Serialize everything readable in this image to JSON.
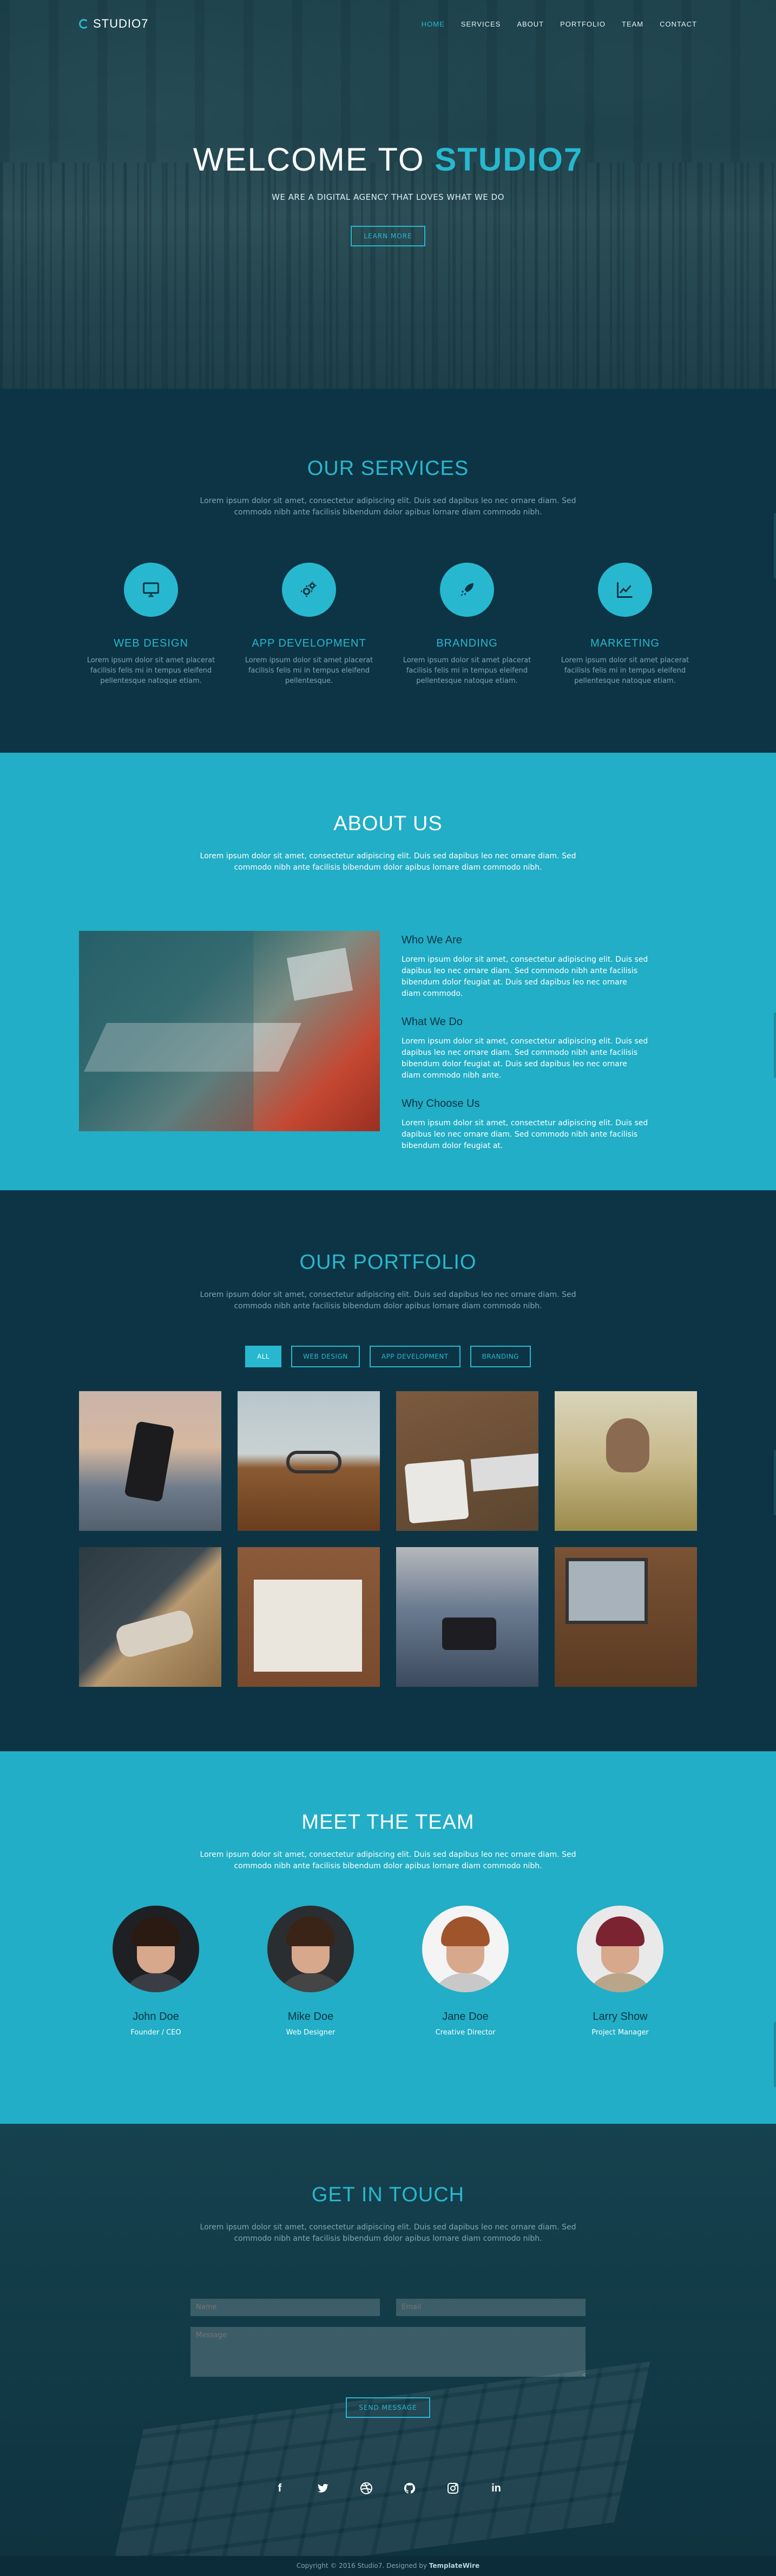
{
  "brand": {
    "name": "STUDIO7"
  },
  "nav": {
    "items": [
      "HOME",
      "SERVICES",
      "ABOUT",
      "PORTFOLIO",
      "TEAM",
      "CONTACT"
    ],
    "active": "HOME"
  },
  "hero": {
    "title_prefix": "WELCOME TO ",
    "title_accent": "STUDIO7",
    "subtitle": "WE ARE A DIGITAL AGENCY THAT LOVES WHAT WE DO",
    "button": "LEARN MORE"
  },
  "lorem": "Lorem ipsum dolor sit amet, consectetur adipiscing elit. Duis sed dapibus leo nec ornare diam. Sed commodo nibh ante facilisis bibendum dolor apibus lornare diam commodo nibh.",
  "services": {
    "title": "OUR SERVICES",
    "text": "Lorem ipsum dolor sit amet, consectetur adipiscing elit. Duis sed dapibus leo nec ornare diam. Sed commodo nibh ante facilisis bibendum dolor apibus lornare diam commodo nibh.",
    "items": [
      {
        "title": "WEB DESIGN",
        "icon": "monitor-icon",
        "text": "Lorem ipsum dolor sit amet placerat facilisis felis mi in tempus eleifend pellentesque natoque etiam."
      },
      {
        "title": "APP DEVELOPMENT",
        "icon": "gears-icon",
        "text": "Lorem ipsum dolor sit amet placerat facilisis felis mi in tempus eleifend pellentesque."
      },
      {
        "title": "BRANDING",
        "icon": "rocket-icon",
        "text": "Lorem ipsum dolor sit amet placerat facilisis felis mi in tempus eleifend pellentesque natoque etiam."
      },
      {
        "title": "MARKETING",
        "icon": "chart-icon",
        "text": "Lorem ipsum dolor sit amet placerat facilisis felis mi in tempus eleifend pellentesque natoque etiam."
      }
    ]
  },
  "about": {
    "title": "ABOUT US",
    "text": "Lorem ipsum dolor sit amet, consectetur adipiscing elit. Duis sed dapibus leo nec ornare diam. Sed commodo nibh ante facilisis bibendum dolor apibus lornare diam commodo nibh.",
    "blocks": [
      {
        "heading": "Who We Are",
        "text": "Lorem ipsum dolor sit amet, consectetur adipiscing elit. Duis sed dapibus leo nec ornare diam. Sed commodo nibh ante facilisis bibendum dolor feugiat at. Duis sed dapibus leo nec ornare diam commodo."
      },
      {
        "heading": "What We Do",
        "text": "Lorem ipsum dolor sit amet, consectetur adipiscing elit. Duis sed dapibus leo nec ornare diam. Sed commodo nibh ante facilisis bibendum dolor feugiat at. Duis sed dapibus leo nec ornare diam commodo nibh ante."
      },
      {
        "heading": "Why Choose Us",
        "text": "Lorem ipsum dolor sit amet, consectetur adipiscing elit. Duis sed dapibus leo nec ornare diam. Sed commodo nibh ante facilisis bibendum dolor feugiat at."
      }
    ]
  },
  "portfolio": {
    "title": "OUR PORTFOLIO",
    "text": "Lorem ipsum dolor sit amet, consectetur adipiscing elit. Duis sed dapibus leo nec ornare diam. Sed commodo nibh ante facilisis bibendum dolor apibus lornare diam commodo nibh.",
    "filters": [
      "ALL",
      "WEB DESIGN",
      "APP DEVELOPMENT",
      "BRANDING"
    ],
    "active_filter": "ALL"
  },
  "team": {
    "title": "MEET THE TEAM",
    "text": "Lorem ipsum dolor sit amet, consectetur adipiscing elit. Duis sed dapibus leo nec ornare diam. Sed commodo nibh ante facilisis bibendum dolor apibus lornare diam commodo nibh.",
    "members": [
      {
        "name": "John Doe",
        "role": "Founder / CEO"
      },
      {
        "name": "Mike Doe",
        "role": "Web Designer"
      },
      {
        "name": "Jane Doe",
        "role": "Creative Director"
      },
      {
        "name": "Larry Show",
        "role": "Project Manager"
      }
    ]
  },
  "contact": {
    "title": "GET IN TOUCH",
    "text": "Lorem ipsum dolor sit amet, consectetur adipiscing elit. Duis sed dapibus leo nec ornare diam. Sed commodo nibh ante facilisis bibendum dolor apibus lornare diam commodo nibh.",
    "name_placeholder": "Name",
    "email_placeholder": "Email",
    "message_placeholder": "Message",
    "button": "SEND MESSAGE"
  },
  "socials": [
    "facebook-icon",
    "twitter-icon",
    "dribbble-icon",
    "github-icon",
    "instagram-icon",
    "linkedin-icon"
  ],
  "footer": {
    "text": "Copyright © 2016 Studio7. Designed by ",
    "designer": "TemplateWire"
  },
  "colors": {
    "accent": "#27b8d0",
    "dark": "#0d3444",
    "teal": "#21aec6"
  }
}
